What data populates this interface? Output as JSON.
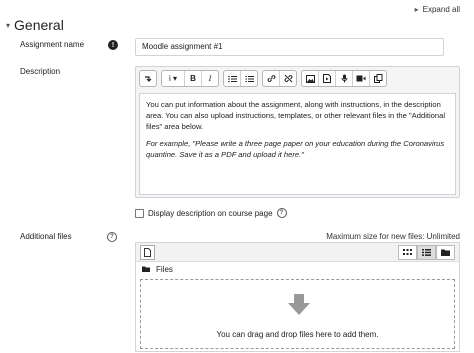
{
  "header": {
    "expand_all": "Expand all"
  },
  "section": {
    "title": "General"
  },
  "fields": {
    "name_label": "Assignment name",
    "name_value": "Moodle assignment #1",
    "description_label": "Description",
    "description_p1": "You can put information about the assignment, along with instructions, in the description area. You can also upload instructions, templates, or other relevant files in the \"Additional files\" area below.",
    "description_p2": "For example, \"Please write a three page paper on your education during the Coronavirus quantine. Save it as a PDF and upload it here.\"",
    "show_description": "Display description on course page",
    "files_label": "Additional files",
    "max_size": "Maximum size for new files: Unlimited",
    "files_folder": "Files",
    "drop_message": "You can drag and drop files here to add them."
  },
  "toolbar": {
    "groups": [
      [
        "show-more-icon"
      ],
      [
        "paragraph-style-icon",
        "bold-icon",
        "italic-icon"
      ],
      [
        "unordered-list-icon",
        "ordered-list-icon"
      ],
      [
        "link-icon",
        "unlink-icon"
      ],
      [
        "image-icon",
        "media-icon",
        "record-audio-icon",
        "record-video-icon",
        "manage-files-icon"
      ]
    ]
  }
}
